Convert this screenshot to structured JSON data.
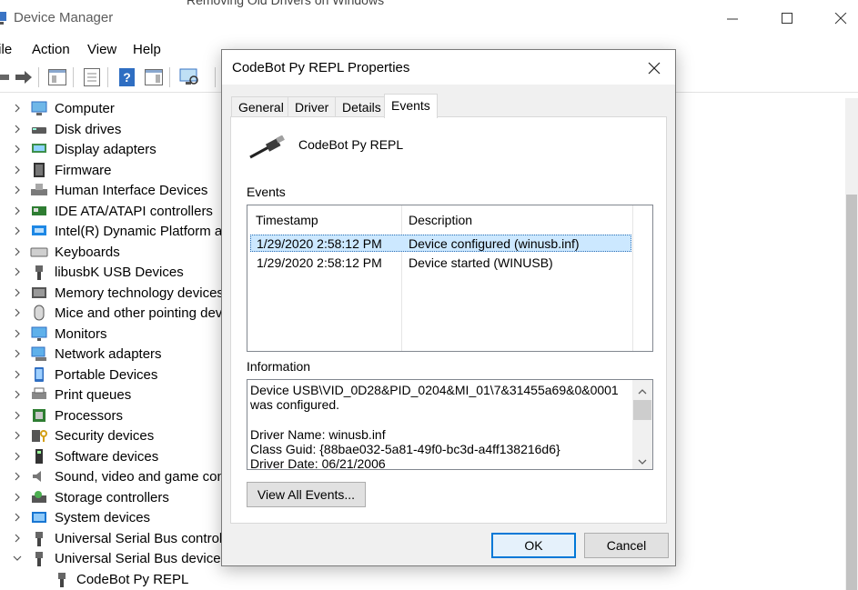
{
  "window": {
    "title": "Device Manager",
    "peek_text": "Removing Old Drivers on Windows",
    "menus": [
      "File",
      "Action",
      "View",
      "Help"
    ]
  },
  "tree": {
    "items": [
      {
        "label": "Computer",
        "icon": "computer-icon"
      },
      {
        "label": "Disk drives",
        "icon": "disk-drive-icon"
      },
      {
        "label": "Display adapters",
        "icon": "display-adapter-icon"
      },
      {
        "label": "Firmware",
        "icon": "firmware-icon"
      },
      {
        "label": "Human Interface Devices",
        "icon": "hid-icon"
      },
      {
        "label": "IDE ATA/ATAPI controllers",
        "icon": "ide-controller-icon"
      },
      {
        "label": "Intel(R) Dynamic Platform and Thermal Framework",
        "icon": "intel-platform-icon"
      },
      {
        "label": "Keyboards",
        "icon": "keyboard-icon"
      },
      {
        "label": "libusbK USB Devices",
        "icon": "usb-plug-icon"
      },
      {
        "label": "Memory technology devices",
        "icon": "memory-device-icon"
      },
      {
        "label": "Mice and other pointing devices",
        "icon": "mouse-icon"
      },
      {
        "label": "Monitors",
        "icon": "monitor-icon"
      },
      {
        "label": "Network adapters",
        "icon": "network-adapter-icon"
      },
      {
        "label": "Portable Devices",
        "icon": "portable-device-icon"
      },
      {
        "label": "Print queues",
        "icon": "printer-icon"
      },
      {
        "label": "Processors",
        "icon": "processor-icon"
      },
      {
        "label": "Security devices",
        "icon": "security-device-icon"
      },
      {
        "label": "Software devices",
        "icon": "software-device-icon"
      },
      {
        "label": "Sound, video and game controllers",
        "icon": "speaker-icon"
      },
      {
        "label": "Storage controllers",
        "icon": "storage-controller-icon"
      },
      {
        "label": "System devices",
        "icon": "system-device-icon"
      },
      {
        "label": "Universal Serial Bus controllers",
        "icon": "usb-plug-icon"
      },
      {
        "label": "Universal Serial Bus devices",
        "icon": "usb-plug-icon",
        "expanded": true
      }
    ],
    "child": {
      "label": "CodeBot Py REPL",
      "icon": "usb-plug-icon"
    }
  },
  "dialog": {
    "title": "CodeBot Py REPL Properties",
    "tabs": [
      "General",
      "Driver",
      "Details",
      "Events"
    ],
    "active_tab": "Events",
    "device_name": "CodeBot Py REPL",
    "events_label": "Events",
    "columns": [
      "Timestamp",
      "Description"
    ],
    "events": [
      {
        "timestamp": "1/29/2020 2:58:12 PM",
        "description": "Device configured (winusb.inf)"
      },
      {
        "timestamp": "1/29/2020 2:58:12 PM",
        "description": "Device started (WINUSB)"
      }
    ],
    "information_label": "Information",
    "information_lines": [
      "Device USB\\VID_0D28&PID_0204&MI_01\\7&31455a69&0&0001 was configured.",
      "",
      "Driver Name: winusb.inf",
      "Class Guid: {88bae032-5a81-49f0-bc3d-a4ff138216d6}",
      "Driver Date: 06/21/2006"
    ],
    "view_all_label": "View All Events...",
    "ok_label": "OK",
    "cancel_label": "Cancel"
  }
}
